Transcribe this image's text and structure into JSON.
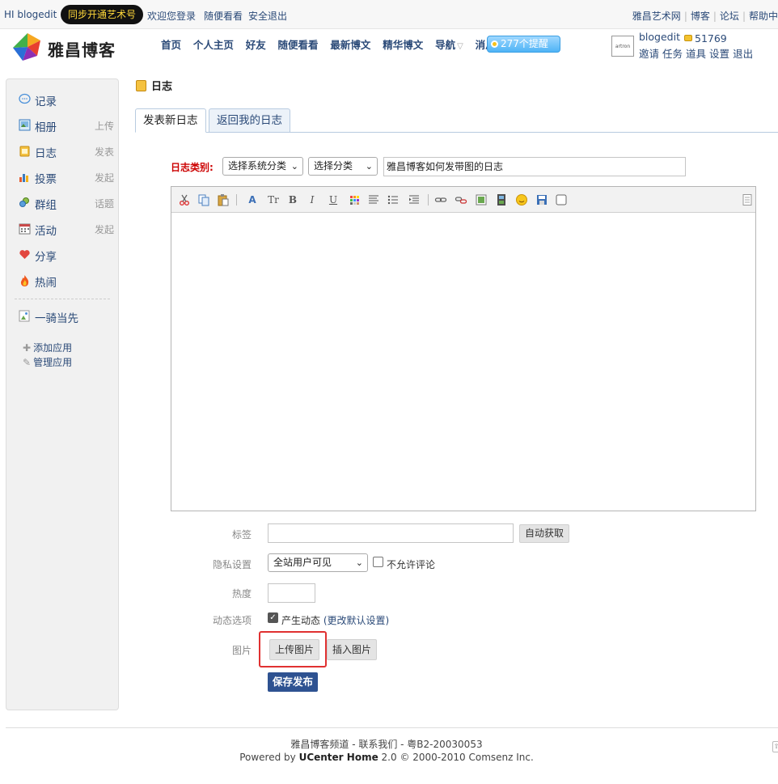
{
  "topbar": {
    "greeting": "HI blogedit",
    "promo": "同步开通艺术号",
    "welcome": "欢迎您登录",
    "random": "随便看看",
    "logout": "安全退出",
    "right_links": [
      "雅昌艺术网",
      "博客",
      "论坛",
      "帮助中"
    ]
  },
  "header": {
    "site_name": "雅昌博客",
    "nav": [
      "首页",
      "个人主页",
      "好友",
      "随便看看",
      "最新博文",
      "精华博文",
      "导航",
      "消息"
    ],
    "remind": "277个提醒",
    "avatar_text": "artron",
    "username": "blogedit",
    "coins": "51769",
    "user_menu": [
      "邀请",
      "任务",
      "道具",
      "设置",
      "退出"
    ]
  },
  "sidebar": {
    "items": [
      {
        "label": "记录",
        "action": ""
      },
      {
        "label": "相册",
        "action": "上传"
      },
      {
        "label": "日志",
        "action": "发表"
      },
      {
        "label": "投票",
        "action": "发起"
      },
      {
        "label": "群组",
        "action": "话题"
      },
      {
        "label": "活动",
        "action": "发起"
      },
      {
        "label": "分享",
        "action": ""
      },
      {
        "label": "热闹",
        "action": ""
      }
    ],
    "app_featured": "一骑当先",
    "add_app": "添加应用",
    "manage_app": "管理应用"
  },
  "main": {
    "title": "日志",
    "tabs": [
      "发表新日志",
      "返回我的日志"
    ],
    "category_label": "日志类别:",
    "sys_category": "选择系统分类",
    "category": "选择分类",
    "post_title": "雅昌博客如何发带图的日志",
    "form": {
      "tag_label": "标签",
      "auto_fetch": "自动获取",
      "privacy_label": "隐私设置",
      "privacy_value": "全站用户可见",
      "no_comment": "不允许评论",
      "heat_label": "热度",
      "feed_label": "动态选项",
      "feed_text": "产生动态",
      "feed_link": "(更改默认设置)",
      "image_label": "图片",
      "upload_image": "上传图片",
      "insert_image": "插入图片",
      "save": "保存发布"
    }
  },
  "footer": {
    "line1": "雅昌博客频道 - 联系我们 - 粤B2-20030053",
    "powered": "Powered by",
    "product": "UCenter Home",
    "version": "2.0 © 2000-2010 Comsenz Inc."
  }
}
